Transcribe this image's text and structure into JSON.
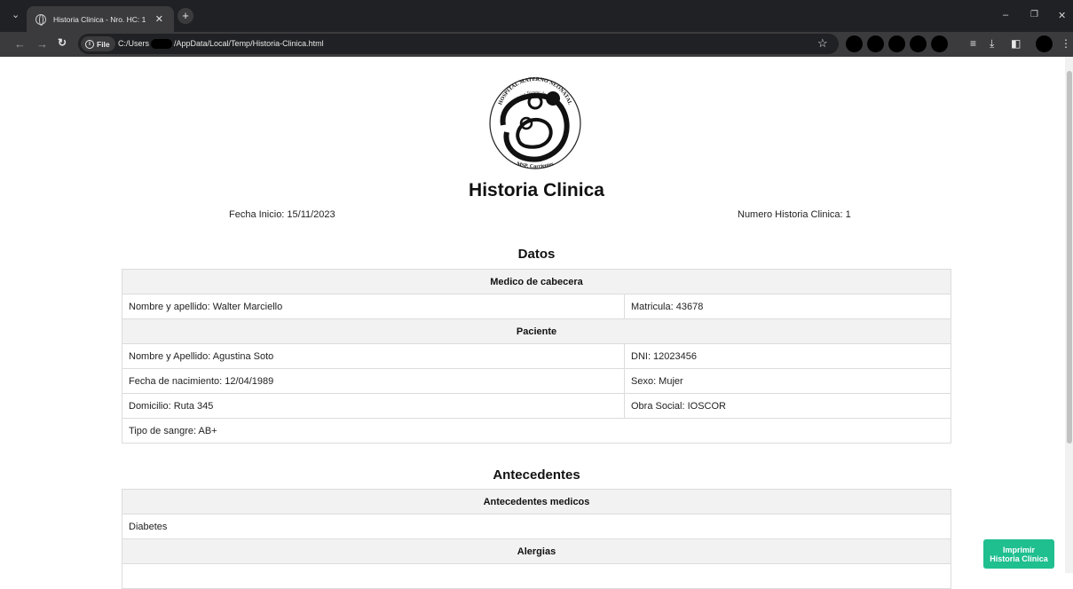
{
  "browser": {
    "tab_title": "Historia Clinica - Nro. HC: 1",
    "tab_close": "✕",
    "new_tab": "+",
    "tab_menu": "⌄",
    "file_chip": "File",
    "url_prefix": "C:/Users",
    "url_suffix": "/AppData/Local/Temp/Historia-Clinica.html",
    "minimize": "–",
    "restore": "❐",
    "close": "✕"
  },
  "logo": {
    "text_top": "HOSPITAL MATERNO NEONATAL",
    "text_sub": "Eloisa Torrent de Vidal",
    "text_bottom": "MSP. Corrientes"
  },
  "page": {
    "title": "Historia Clinica",
    "fecha_inicio": "Fecha Inicio: 15/11/2023",
    "numero_hc": "Numero Historia Clinica: 1"
  },
  "datos": {
    "title": "Datos",
    "medico_header": "Medico de cabecera",
    "medico_nombre": "Nombre y apellido: Walter Marciello",
    "medico_matricula": "Matricula: 43678",
    "paciente_header": "Paciente",
    "paciente_nombre": "Nombre y Apellido: Agustina Soto",
    "paciente_dni": "DNI: 12023456",
    "paciente_nacimiento": "Fecha de nacimiento: 12/04/1989",
    "paciente_sexo": "Sexo: Mujer",
    "paciente_domicilio": "Domicilio: Ruta 345",
    "paciente_obra_social": "Obra Social: IOSCOR",
    "paciente_sangre": "Tipo de sangre: AB+"
  },
  "antecedentes": {
    "title": "Antecedentes",
    "medicos_header": "Antecedentes medicos",
    "medicos_value": "Diabetes",
    "alergias_header": "Alergias"
  },
  "print_button": {
    "line1": "Imprimir",
    "line2": "Historia Clinica"
  },
  "colors": {
    "accent": "#1fbf8f",
    "header_bg": "#f2f2f2",
    "chrome_dark": "#202124",
    "chrome_mid": "#3b3b3d"
  }
}
